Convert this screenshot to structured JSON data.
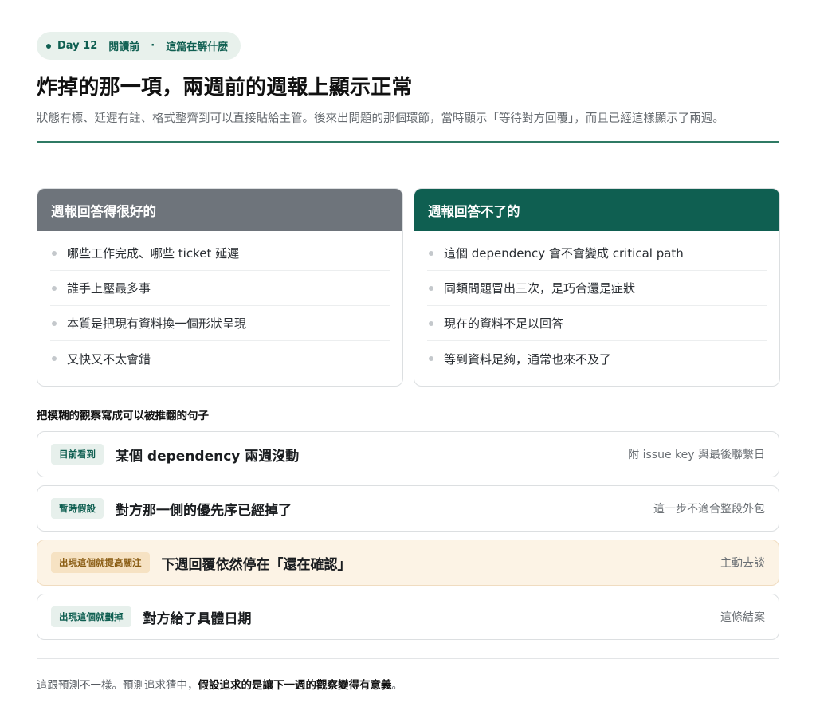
{
  "header": {
    "pill": {
      "day": "Day 12",
      "phase": "閱讀前",
      "sep": "·",
      "topic": "這篇在解什麼"
    },
    "title": "炸掉的那一項，兩週前的週報上顯示正常",
    "intro": "狀態有標、延遲有註、格式整齊到可以直接貼給主管。後來出問題的那個環節，當時顯示「等待對方回覆」，而且已經這樣顯示了兩週。"
  },
  "left_card": {
    "title": "週報回答得很好的",
    "items": [
      "哪些工作完成、哪些 ticket 延遲",
      "誰手上壓最多事",
      "本質是把現有資料換一個形狀呈現",
      "又快又不太會錯"
    ]
  },
  "right_card": {
    "title": "週報回答不了的",
    "items": [
      "這個 dependency 會不會變成 critical path",
      "同類問題冒出三次，是巧合還是症狀",
      "現在的資料不足以回答",
      "等到資料足夠，通常也來不及了"
    ]
  },
  "section_title": "把模糊的觀察寫成可以被推翻的句子",
  "rows": [
    {
      "tag": "目前看到",
      "text": "某個 dependency 兩週沒動",
      "note": "附 issue key 與最後聯繫日"
    },
    {
      "tag": "暫時假設",
      "text": "對方那一側的優先序已經掉了",
      "note": "這一步不適合整段外包"
    },
    {
      "tag": "出現這個就提高關注",
      "text": "下週回覆依然停在「還在確認」",
      "note": "主動去談"
    },
    {
      "tag": "出現這個就劃掉",
      "text": "對方給了具體日期",
      "note": "這條結案"
    }
  ],
  "footer": {
    "lead": "這跟預測不一樣。預測追求猜中，",
    "emphasis": "假設追求的是讓下一週的觀察變得有意義",
    "tail": "。"
  },
  "colors": {
    "accent": "#0f5f51",
    "muted_header": "#6e747b",
    "warn_bg": "#fcf3e5",
    "pill_bg": "#e8f1ec"
  }
}
